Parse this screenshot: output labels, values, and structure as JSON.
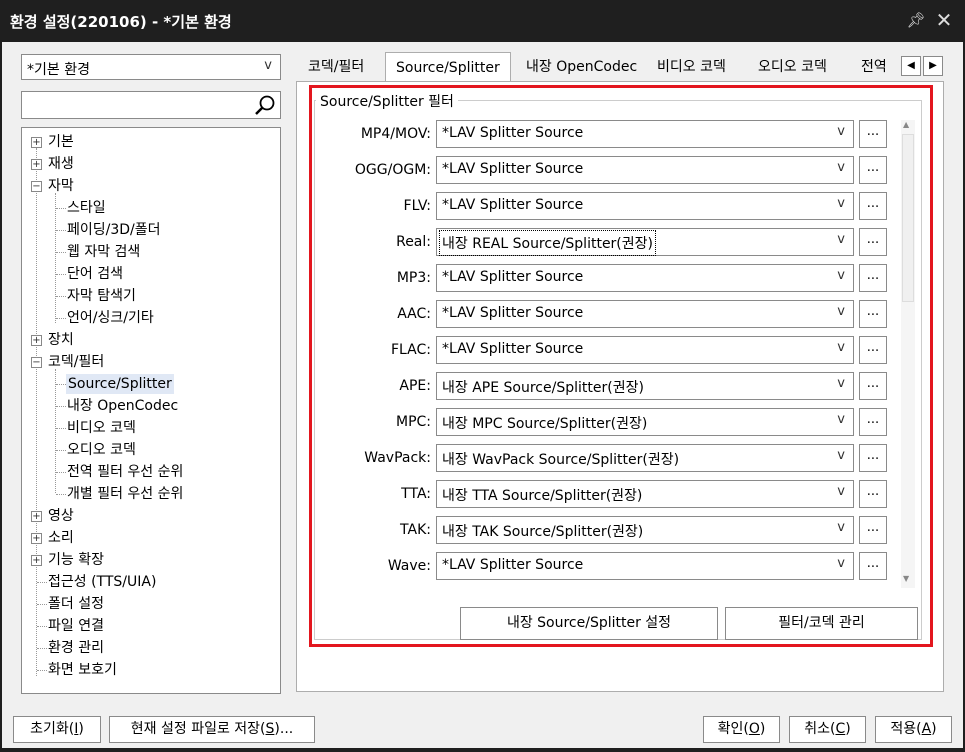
{
  "window": {
    "title": "환경 설정(220106) - *기본 환경"
  },
  "profile": {
    "value": "*기본 환경"
  },
  "search": {
    "value": ""
  },
  "tree": [
    {
      "label": "기본"
    },
    {
      "label": "재생"
    },
    {
      "label": "자막"
    },
    {
      "label": "스타일"
    },
    {
      "label": "페이딩/3D/폴더"
    },
    {
      "label": "웹 자막 검색"
    },
    {
      "label": "단어 검색"
    },
    {
      "label": "자막 탐색기"
    },
    {
      "label": "언어/싱크/기타"
    },
    {
      "label": "장치"
    },
    {
      "label": "코덱/필터"
    },
    {
      "label": "Source/Splitter"
    },
    {
      "label": "내장 OpenCodec"
    },
    {
      "label": "비디오 코덱"
    },
    {
      "label": "오디오 코덱"
    },
    {
      "label": "전역 필터 우선 순위"
    },
    {
      "label": "개별 필터 우선 순위"
    },
    {
      "label": "영상"
    },
    {
      "label": "소리"
    },
    {
      "label": "기능 확장"
    },
    {
      "label": "접근성 (TTS/UIA)"
    },
    {
      "label": "폴더 설정"
    },
    {
      "label": "파일 연결"
    },
    {
      "label": "환경 관리"
    },
    {
      "label": "화면 보호기"
    }
  ],
  "tabs": [
    "코덱/필터",
    "Source/Splitter",
    "내장 OpenCodec",
    "비디오 코덱",
    "오디오 코덱",
    "전역"
  ],
  "group": {
    "title": "Source/Splitter 필터"
  },
  "rows": [
    {
      "label": "MP4/MOV:",
      "value": "*LAV Splitter Source"
    },
    {
      "label": "OGG/OGM:",
      "value": "*LAV Splitter Source"
    },
    {
      "label": "FLV:",
      "value": "*LAV Splitter Source"
    },
    {
      "label": "Real:",
      "value": "내장 REAL Source/Splitter(권장)"
    },
    {
      "label": "MP3:",
      "value": "*LAV Splitter Source"
    },
    {
      "label": "AAC:",
      "value": "*LAV Splitter Source"
    },
    {
      "label": "FLAC:",
      "value": "*LAV Splitter Source"
    },
    {
      "label": "APE:",
      "value": "내장 APE Source/Splitter(권장)"
    },
    {
      "label": "MPC:",
      "value": "내장 MPC Source/Splitter(권장)"
    },
    {
      "label": "WavPack:",
      "value": "내장 WavPack Source/Splitter(권장)"
    },
    {
      "label": "TTA:",
      "value": "내장 TTA Source/Splitter(권장)"
    },
    {
      "label": "TAK:",
      "value": "내장 TAK Source/Splitter(권장)"
    },
    {
      "label": "Wave:",
      "value": "*LAV Splitter Source"
    }
  ],
  "more_label": "...",
  "buttons": {
    "internal_settings": "내장 Source/Splitter 설정",
    "filter_manage": "필터/코덱 관리",
    "reset": "초기화(",
    "reset_key": "I",
    "reset_tail": ")",
    "save_file": "현재 설정 파일로 저장(",
    "save_key": "S",
    "save_tail": ")...",
    "ok": "확인(",
    "ok_key": "O",
    "ok_tail": ")",
    "cancel": "취소(",
    "cancel_key": "C",
    "cancel_tail": ")",
    "apply": "적용(",
    "apply_key": "A",
    "apply_tail": ")"
  },
  "colors": {
    "highlight": "#e3161e",
    "titlebar": "#1f1f1f",
    "selection": "#e0e8f5"
  }
}
